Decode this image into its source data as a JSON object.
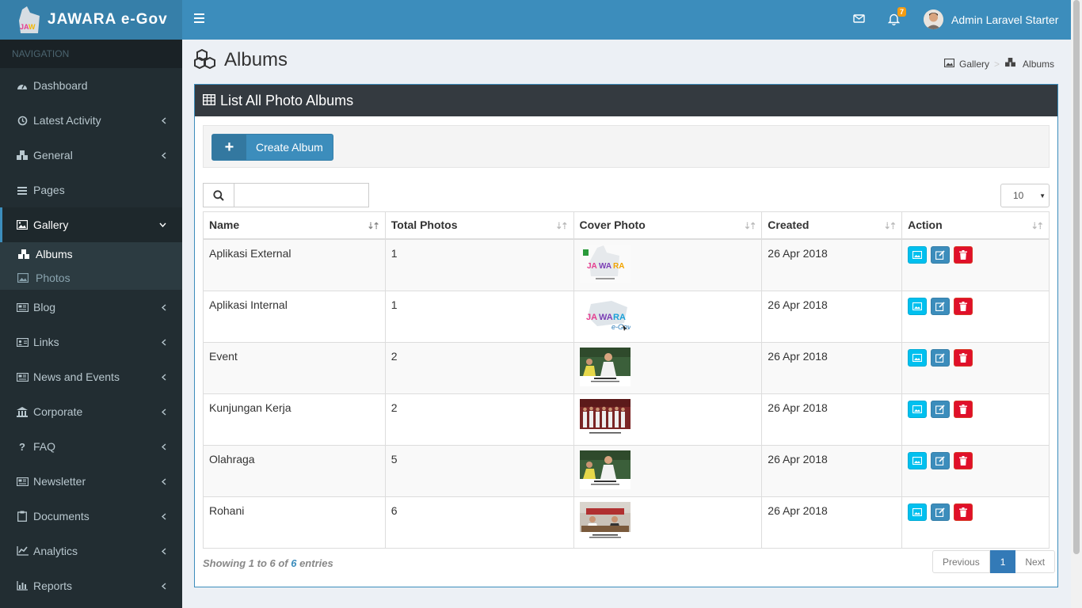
{
  "app": {
    "logo_text": "JAWARA e-Gov",
    "user_name": "Admin Laravel Starter",
    "notification_count": "7"
  },
  "sidebar": {
    "header": "NAVIGATION",
    "items": [
      {
        "label": "Dashboard",
        "icon": "dashboard-icon"
      },
      {
        "label": "Latest Activity",
        "icon": "history-icon"
      },
      {
        "label": "General",
        "icon": "cubes-icon"
      },
      {
        "label": "Pages",
        "icon": "bars-icon"
      },
      {
        "label": "Gallery",
        "icon": "image-icon"
      },
      {
        "label": "Blog",
        "icon": "newspaper-icon"
      },
      {
        "label": "Links",
        "icon": "address-card-icon"
      },
      {
        "label": "News and Events",
        "icon": "newspaper-icon"
      },
      {
        "label": "Corporate",
        "icon": "bank-icon"
      },
      {
        "label": "FAQ",
        "icon": "question-icon"
      },
      {
        "label": "Newsletter",
        "icon": "newspaper-icon"
      },
      {
        "label": "Documents",
        "icon": "clipboard-icon"
      },
      {
        "label": "Analytics",
        "icon": "line-chart-icon"
      },
      {
        "label": "Reports",
        "icon": "bar-chart-icon"
      }
    ],
    "gallery_sub": [
      {
        "label": "Albums",
        "icon": "cubes-icon"
      },
      {
        "label": "Photos",
        "icon": "image-icon"
      }
    ]
  },
  "page": {
    "title": "Albums",
    "breadcrumb": [
      "Gallery",
      "Albums"
    ]
  },
  "box": {
    "title": "List All Photo Albums",
    "create_label": "Create Album",
    "search_placeholder": "",
    "page_length": "10"
  },
  "table": {
    "columns": [
      "Name",
      "Total Photos",
      "Cover Photo",
      "Created",
      "Action"
    ],
    "rows": [
      {
        "name": "Aplikasi External",
        "total": "1",
        "cover": "jawara-logo-white",
        "created": "26 Apr 2018"
      },
      {
        "name": "Aplikasi Internal",
        "total": "1",
        "cover": "jawara-egov-logo",
        "created": "26 Apr 2018"
      },
      {
        "name": "Event",
        "total": "2",
        "cover": "event-photo",
        "created": "26 Apr 2018"
      },
      {
        "name": "Kunjungan Kerja",
        "total": "2",
        "cover": "group-photo",
        "created": "26 Apr 2018"
      },
      {
        "name": "Olahraga",
        "total": "5",
        "cover": "event-photo",
        "created": "26 Apr 2018"
      },
      {
        "name": "Rohani",
        "total": "6",
        "cover": "meeting-photo",
        "created": "26 Apr 2018"
      }
    ]
  },
  "footer": {
    "info_prefix": "Showing 1 to 6 of ",
    "info_total": "6",
    "info_suffix": " entries",
    "prev": "Previous",
    "page": "1",
    "next": "Next"
  },
  "colors": {
    "brand": "#3c8dbc",
    "sidebar": "#222d32",
    "box_header": "#343a40",
    "info_btn": "#00c0ef",
    "danger_btn": "#e0102a"
  }
}
